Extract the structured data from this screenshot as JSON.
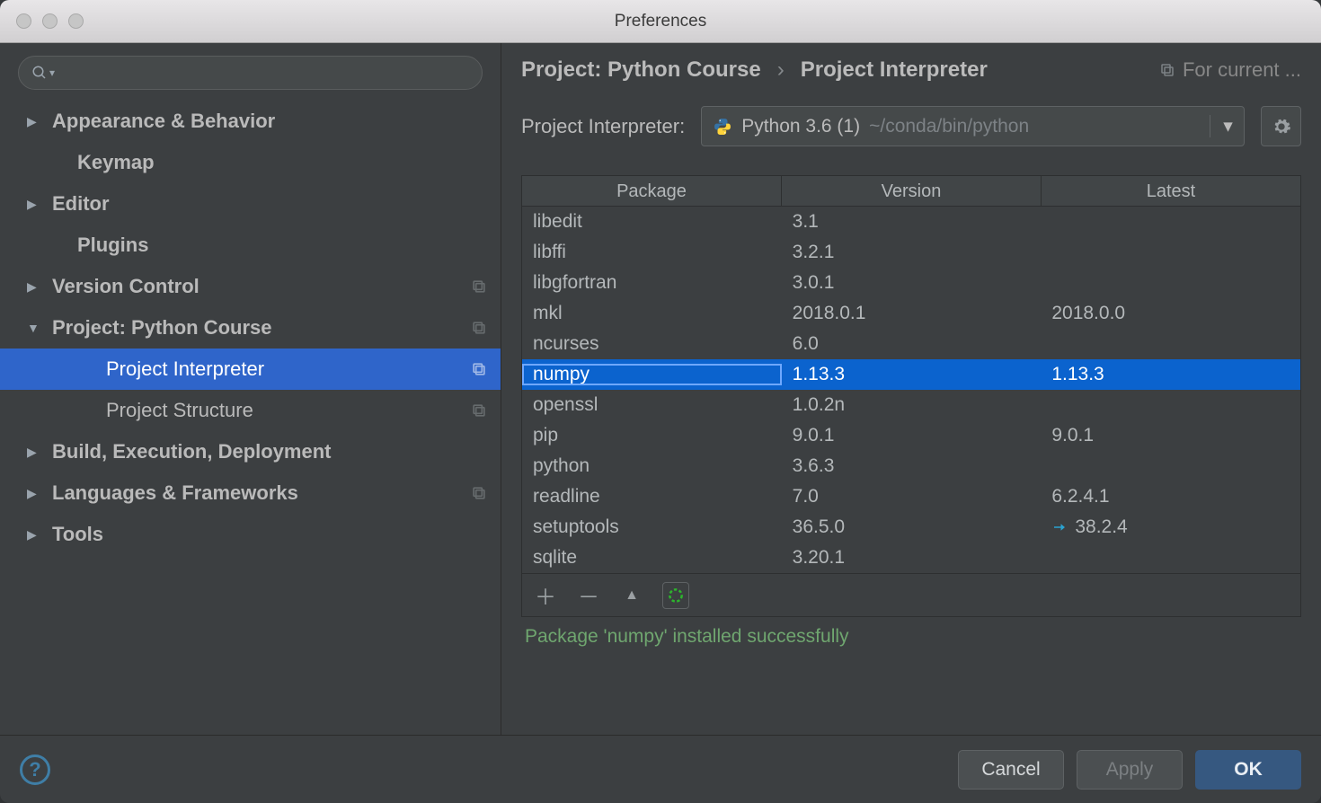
{
  "window": {
    "title": "Preferences"
  },
  "search": {
    "placeholder": "",
    "icon_label": "Q▾"
  },
  "sidebar": {
    "items": [
      {
        "label": "Appearance & Behavior",
        "expandable": true,
        "expanded": false,
        "copy": false,
        "level": 0
      },
      {
        "label": "Keymap",
        "expandable": false,
        "expanded": false,
        "copy": false,
        "level": 0
      },
      {
        "label": "Editor",
        "expandable": true,
        "expanded": false,
        "copy": false,
        "level": 0
      },
      {
        "label": "Plugins",
        "expandable": false,
        "expanded": false,
        "copy": false,
        "level": 0
      },
      {
        "label": "Version Control",
        "expandable": true,
        "expanded": false,
        "copy": true,
        "level": 0
      },
      {
        "label": "Project: Python Course",
        "expandable": true,
        "expanded": true,
        "copy": true,
        "level": 0
      },
      {
        "label": "Project Interpreter",
        "expandable": false,
        "expanded": false,
        "copy": true,
        "level": 1,
        "selected": true
      },
      {
        "label": "Project Structure",
        "expandable": false,
        "expanded": false,
        "copy": true,
        "level": 1
      },
      {
        "label": "Build, Execution, Deployment",
        "expandable": true,
        "expanded": false,
        "copy": false,
        "level": 0
      },
      {
        "label": "Languages & Frameworks",
        "expandable": true,
        "expanded": false,
        "copy": true,
        "level": 0
      },
      {
        "label": "Tools",
        "expandable": true,
        "expanded": false,
        "copy": false,
        "level": 0
      }
    ]
  },
  "breadcrumb": {
    "project_prefix": "Project: ",
    "project_name": "Python Course",
    "page": "Project Interpreter",
    "scope": "For current ..."
  },
  "interpreter": {
    "label": "Project Interpreter:",
    "name": "Python 3.6 (1)",
    "path": "~/conda/bin/python"
  },
  "packages": {
    "columns": {
      "pkg": "Package",
      "ver": "Version",
      "latest": "Latest"
    },
    "rows": [
      {
        "pkg": "libedit",
        "ver": "3.1",
        "latest": ""
      },
      {
        "pkg": "libffi",
        "ver": "3.2.1",
        "latest": ""
      },
      {
        "pkg": "libgfortran",
        "ver": "3.0.1",
        "latest": ""
      },
      {
        "pkg": "mkl",
        "ver": "2018.0.1",
        "latest": "2018.0.0"
      },
      {
        "pkg": "ncurses",
        "ver": "6.0",
        "latest": ""
      },
      {
        "pkg": "numpy",
        "ver": "1.13.3",
        "latest": "1.13.3",
        "selected": true
      },
      {
        "pkg": "openssl",
        "ver": "1.0.2n",
        "latest": ""
      },
      {
        "pkg": "pip",
        "ver": "9.0.1",
        "latest": "9.0.1"
      },
      {
        "pkg": "python",
        "ver": "3.6.3",
        "latest": ""
      },
      {
        "pkg": "readline",
        "ver": "7.0",
        "latest": "6.2.4.1"
      },
      {
        "pkg": "setuptools",
        "ver": "36.5.0",
        "latest": "38.2.4",
        "upgrade": true
      },
      {
        "pkg": "sqlite",
        "ver": "3.20.1",
        "latest": ""
      }
    ],
    "status": "Package 'numpy' installed successfully"
  },
  "buttons": {
    "cancel": "Cancel",
    "apply": "Apply",
    "ok": "OK"
  }
}
